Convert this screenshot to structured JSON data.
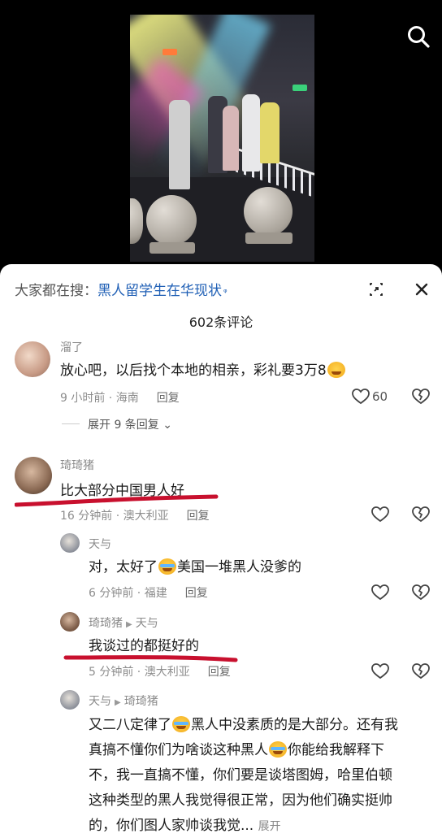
{
  "header": {
    "search_icon": "search-icon"
  },
  "sheet": {
    "search_prefix": "大家都在搜：",
    "search_keyword": "黑人留学生在华现状",
    "search_glyph": "ᵠ",
    "expand_icon": "expand-icon",
    "close_icon": "close-icon",
    "comment_count": "602条评论"
  },
  "comments": [
    {
      "name": "溜了",
      "text_a": "放心吧，以后找个本地的相亲，彩礼要3万8",
      "time_loc": "9 小时前 · 海南",
      "reply": "回复",
      "likes": "60",
      "more": "展开 9 条回复"
    },
    {
      "name": "琦琦猪",
      "text": "比大部分中国男人好",
      "time_loc": "16 分钟前 · 澳大利亚",
      "reply": "回复"
    }
  ],
  "replies": [
    {
      "name": "天与",
      "text_a": "对，太好了",
      "text_b": "美国一堆黑人没爹的",
      "time_loc": "6 分钟前 · 福建",
      "reply": "回复"
    },
    {
      "name": "琦琦猪",
      "to": "天与",
      "text": "我谈过的都挺好的",
      "time_loc": "5 分钟前 · 澳大利亚",
      "reply": "回复"
    },
    {
      "name": "天与",
      "to": "琦琦猪",
      "line1_a": "又二八定律了",
      "line1_b": "黑人中没素质的是大部分。还有我",
      "line2_a": "真搞不懂你们为啥谈这种黑人",
      "line2_b": "你能给我解释下",
      "line3": "不，我一直搞不懂，你们要是谈塔图姆，哈里伯顿",
      "line4": "这种类型的黑人我觉得很正常，因为他们确实挺帅",
      "line5": "的，你们图人家帅谈我觉...",
      "expand": "展开"
    }
  ],
  "colors": {
    "keyword": "#1f5fb5",
    "mark": "#c8102e"
  }
}
